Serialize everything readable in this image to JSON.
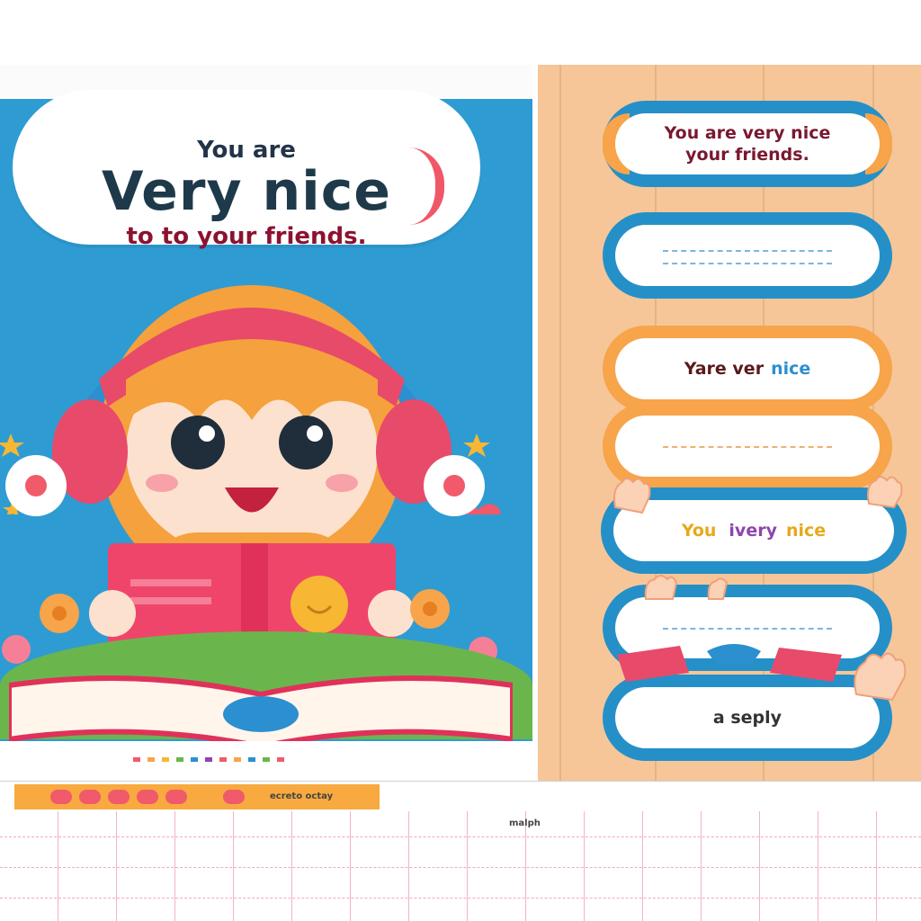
{
  "poster": {
    "bubble": {
      "line1": "You are",
      "line2": "Very nice",
      "line3": "to to your friends."
    },
    "colors": {
      "sky": "#2f9bd3",
      "hat": "#e84a6a",
      "book": "#f0456a",
      "grass": "#6ab64d"
    }
  },
  "cards": [
    {
      "text": "You are very nice\nyour friends.",
      "kind": "text"
    },
    {
      "text": "",
      "kind": "blank"
    },
    {
      "text_dark": "Yare ver",
      "text_blue": "nice",
      "kind": "mixed"
    },
    {
      "text": "",
      "kind": "blank"
    },
    {
      "text_parts": [
        "You",
        "ivery",
        "nice"
      ],
      "kind": "rainbow"
    },
    {
      "text": "",
      "kind": "blank"
    },
    {
      "text": "a seply",
      "kind": "text"
    }
  ],
  "strip": {
    "label_left": "ecreto octay",
    "label_mid": "malph"
  },
  "icons": [
    "star-icon",
    "heart-icon",
    "flower-icon",
    "smiley-icon",
    "hand-icon"
  ]
}
